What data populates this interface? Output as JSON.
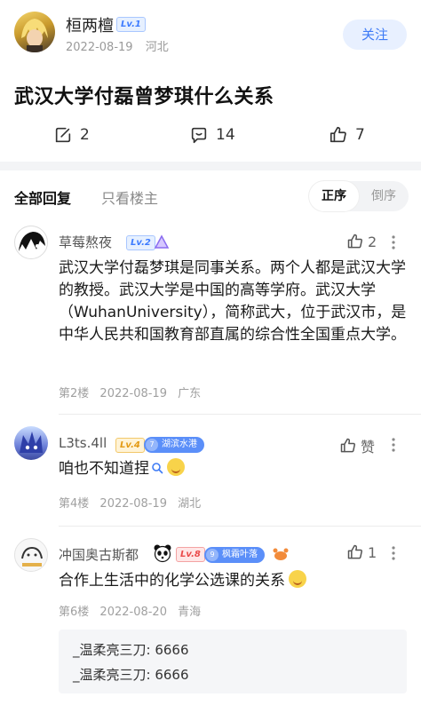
{
  "post": {
    "author": "桓两檀",
    "level": "Lv.1",
    "date": "2022-08-19",
    "location": "河北",
    "follow_label": "关注",
    "title": "武汉大学付磊曾梦琪什么关系",
    "stats": {
      "comments": "2",
      "messages": "14",
      "likes": "7"
    }
  },
  "sort_bar": {
    "all_label": "全部回复",
    "host_only_label": "只看楼主",
    "asc_label": "正序",
    "desc_label": "倒序"
  },
  "comments": [
    {
      "name": "草莓熬夜",
      "level": "Lv.2",
      "likes": "2",
      "text": "武汉大学付磊梦琪是同事关系。两个人都是武汉大学的教授。武汉大学是中国的高等学府。武汉大学（WuhanUniversity），简称武大，位于武汉市，是中华人民共和国教育部直属的综合性全国重点大学。",
      "floor": "第2楼",
      "date": "2022-08-19",
      "location": "广东"
    },
    {
      "name": "L3ts.4ll",
      "level": "Lv.4",
      "tag_num": "7",
      "tag": "湖滨水港",
      "like_label": "赞",
      "text": "咱也不知道捏",
      "floor": "第4楼",
      "date": "2022-08-19",
      "location": "湖北"
    },
    {
      "name": "冲国奥古斯都",
      "level": "Lv.8",
      "tag_num": "9",
      "tag": "枫霜叶落",
      "likes": "1",
      "text": "合作上生活中的化学公选课的关系",
      "floor": "第6楼",
      "date": "2022-08-20",
      "location": "青海",
      "replies": [
        "_温柔亮三刀: 6666",
        "_温柔亮三刀: 6666"
      ]
    }
  ],
  "colors": {
    "accent": "#3e7bf6",
    "tag_blue": "#5b8ff9",
    "tag_red": "#f26b6b"
  }
}
